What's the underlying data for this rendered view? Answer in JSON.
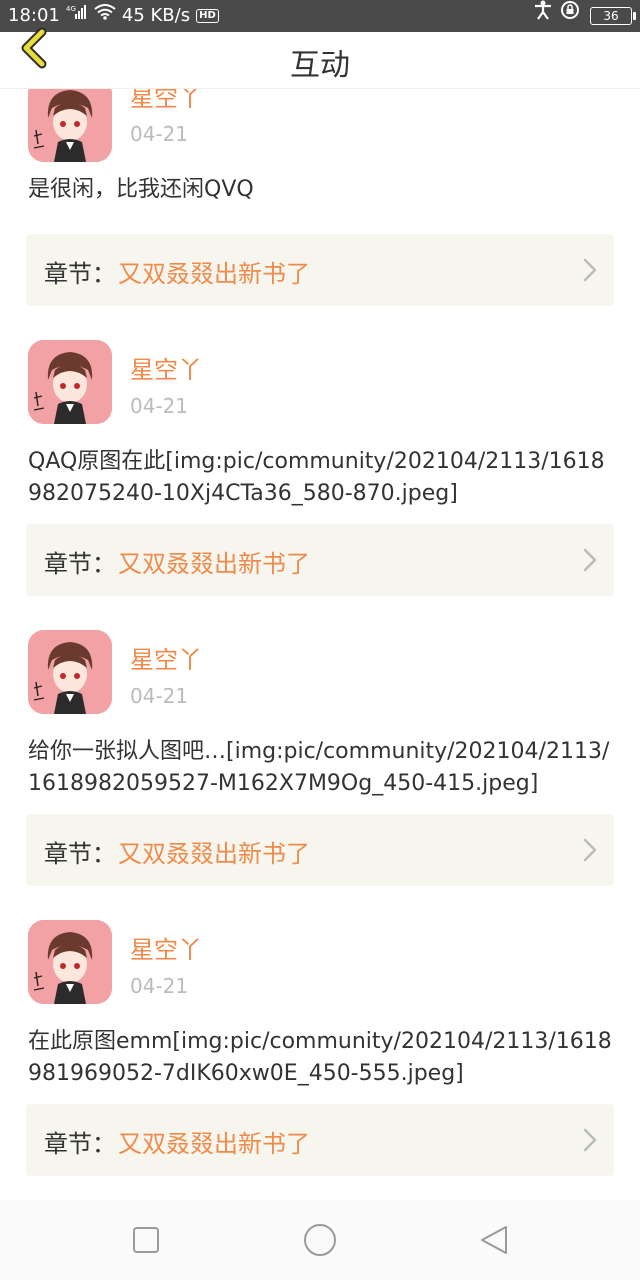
{
  "status_bar": {
    "time": "18:01",
    "network_type": "4G",
    "speed": "45 KB/s",
    "hd": "HD",
    "battery": "36"
  },
  "header": {
    "title": "互动"
  },
  "items": [
    {
      "username": "星空丫",
      "date": "04-21",
      "content": "是很闲，比我还闲QVQ",
      "chapter_prefix": "章节：",
      "chapter_name": "又双叒叕出新书了"
    },
    {
      "username": "星空丫",
      "date": "04-21",
      "content": "QAQ原图在此[img:pic/community/202104/2113/1618982075240-10Xj4CTa36_580-870.jpeg]",
      "chapter_prefix": "章节：",
      "chapter_name": "又双叒叕出新书了"
    },
    {
      "username": "星空丫",
      "date": "04-21",
      "content": "给你一张拟人图吧…[img:pic/community/202104/2113/1618982059527-M162X7M9Og_450-415.jpeg]",
      "chapter_prefix": "章节：",
      "chapter_name": "又双叒叕出新书了"
    },
    {
      "username": "星空丫",
      "date": "04-21",
      "content": "在此原图emm[img:pic/community/202104/2113/1618981969052-7dIK60xw0E_450-555.jpeg]",
      "chapter_prefix": "章节：",
      "chapter_name": "又双叒叕出新书了"
    }
  ],
  "colors": {
    "accent": "#f08a4b",
    "back_arrow": "#e8dc3a",
    "chapter_bg": "#f7f6ee"
  },
  "icons": {
    "back": "back-arrow-icon",
    "chevron": "chevron-right-icon",
    "nav_recent": "square-icon",
    "nav_home": "circle-icon",
    "nav_back": "triangle-back-icon"
  }
}
